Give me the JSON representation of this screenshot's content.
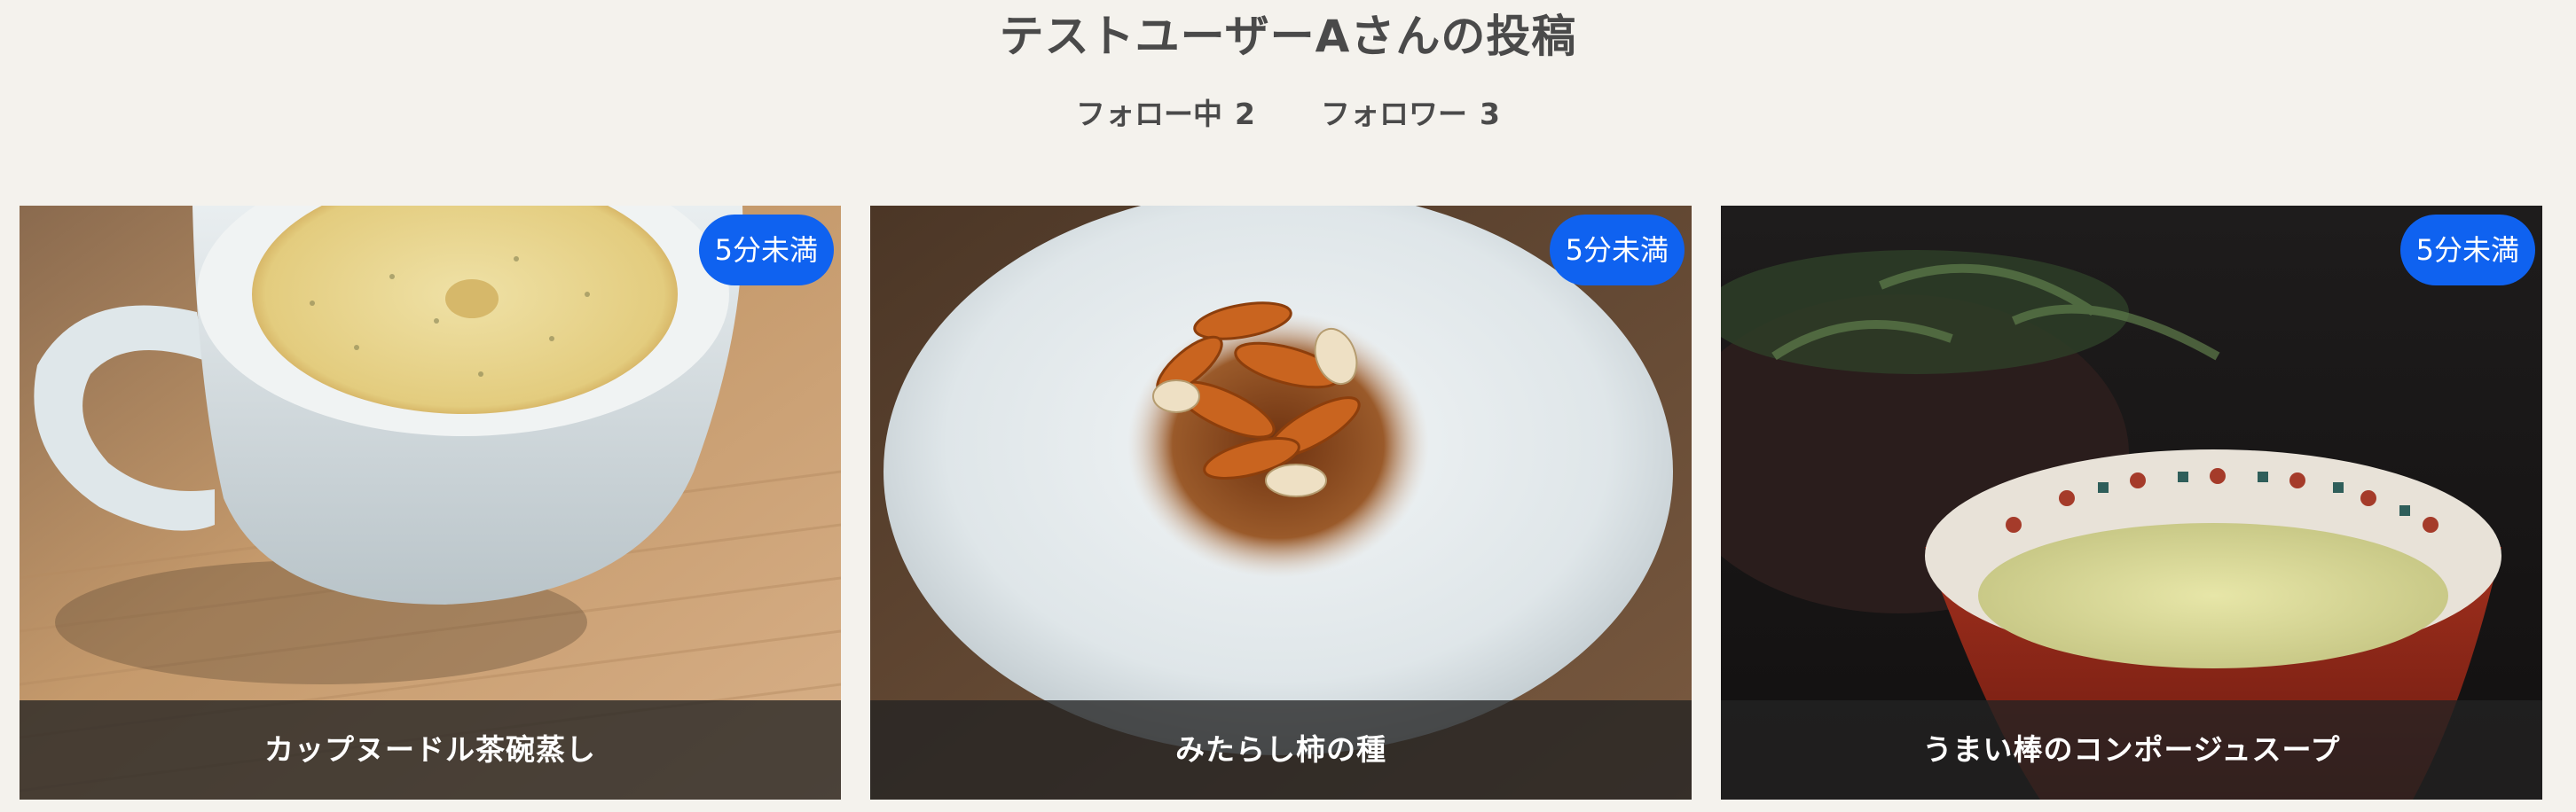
{
  "header": {
    "title": "テストユーザーAさんの投稿",
    "following_label": "フォロー中",
    "following_count": "2",
    "followers_label": "フォロワー",
    "followers_count": "3"
  },
  "posts": [
    {
      "title": "カップヌードル茶碗蒸し",
      "badge": "5分未満",
      "badge_color": "#0f62f0"
    },
    {
      "title": "みたらし柿の種",
      "badge": "5分未満",
      "badge_color": "#0f62f0"
    },
    {
      "title": "うまい棒のコンポージュスープ",
      "badge": "5分未満",
      "badge_color": "#0f62f0"
    }
  ]
}
